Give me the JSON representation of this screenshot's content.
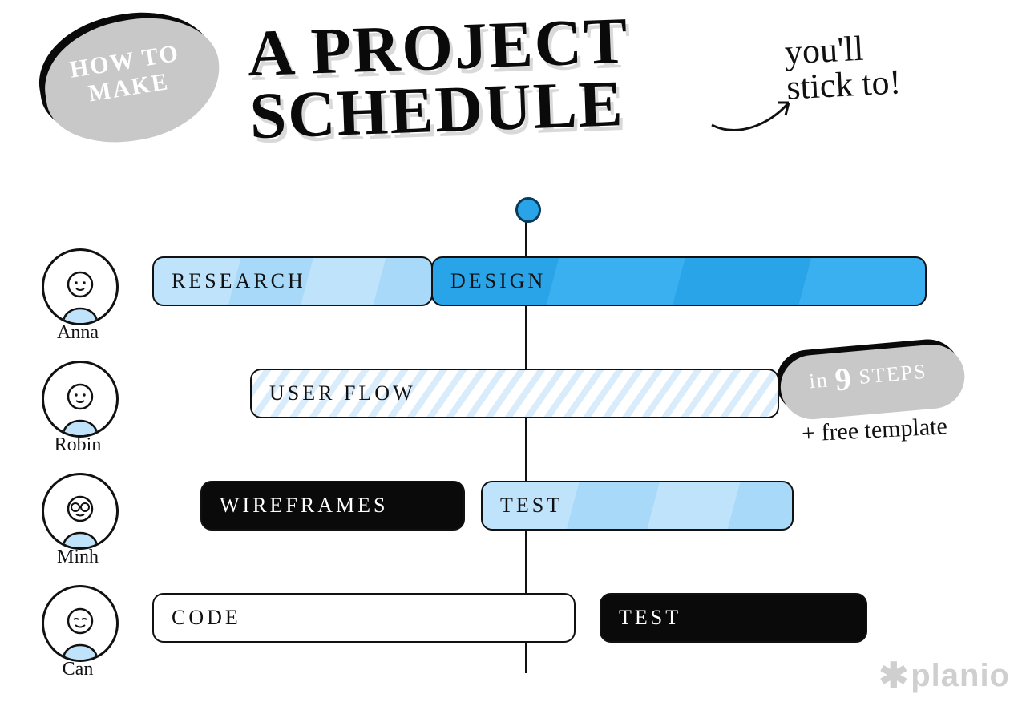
{
  "header": {
    "blob_text": "HOW TO MAKE",
    "title_main": "A PROJECT\nSCHEDULE",
    "title_sub_1": "you'll",
    "title_sub_2": "stick to!",
    "steps_pre": "in",
    "steps_num": "9",
    "steps_post": "STEPS",
    "sub_template": "+ free template"
  },
  "people": [
    {
      "name": "Anna"
    },
    {
      "name": "Robin"
    },
    {
      "name": "Minh"
    },
    {
      "name": "Can"
    }
  ],
  "bars": {
    "research": "RESEARCH",
    "design": "DESIGN",
    "userflow": "USER FLOW",
    "wireframes": "WIREFRAMES",
    "test": "TEST",
    "code": "CODE"
  },
  "brand": "planio",
  "chart_data": {
    "type": "gantt",
    "title": "How to make a project schedule you'll stick to! in 9 steps + free template",
    "current_marker_x": 4.8,
    "x_range": [
      0,
      10
    ],
    "rows": [
      {
        "person": "Anna",
        "tasks": [
          {
            "label": "RESEARCH",
            "start": 0.0,
            "end": 3.6,
            "style": "light-blue"
          },
          {
            "label": "DESIGN",
            "start": 3.6,
            "end": 10.0,
            "style": "blue"
          }
        ]
      },
      {
        "person": "Robin",
        "tasks": [
          {
            "label": "USER FLOW",
            "start": 1.3,
            "end": 8.1,
            "style": "hatched"
          }
        ]
      },
      {
        "person": "Minh",
        "tasks": [
          {
            "label": "WIREFRAMES",
            "start": 0.6,
            "end": 4.0,
            "style": "black"
          },
          {
            "label": "TEST",
            "start": 4.2,
            "end": 8.3,
            "style": "light-blue"
          }
        ]
      },
      {
        "person": "Can",
        "tasks": [
          {
            "label": "CODE",
            "start": 0.0,
            "end": 5.5,
            "style": "white"
          },
          {
            "label": "TEST",
            "start": 5.8,
            "end": 9.2,
            "style": "black"
          }
        ]
      }
    ]
  }
}
